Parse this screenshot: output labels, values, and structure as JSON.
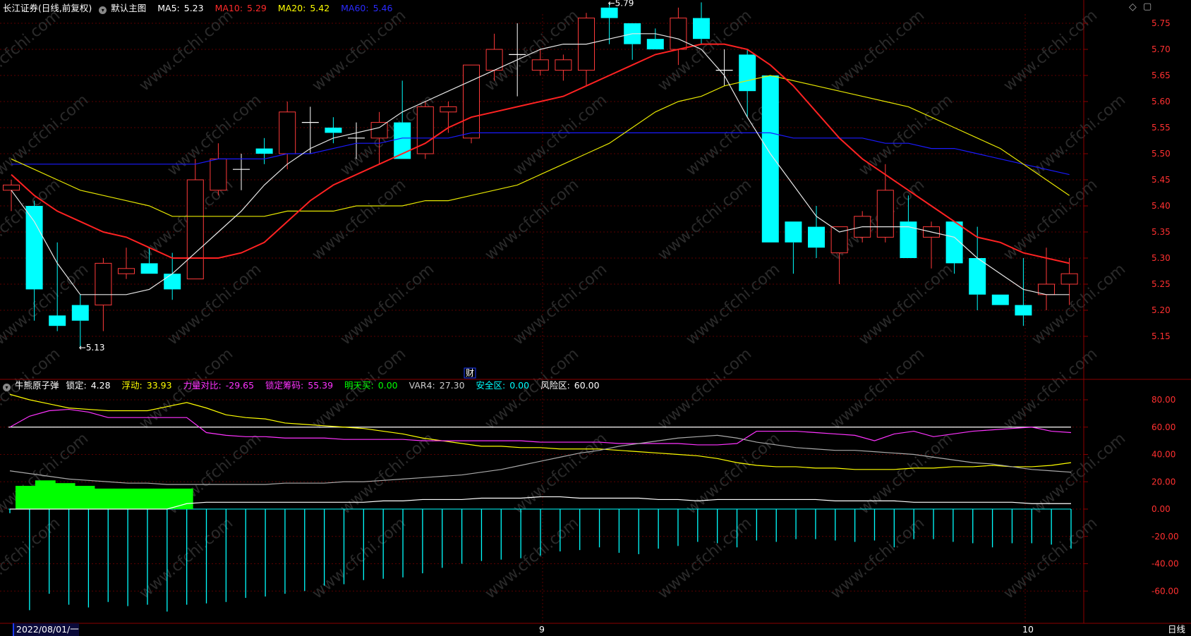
{
  "header": {
    "security": "长江证券",
    "mode": "(日线,前复权)",
    "template": "默认主图",
    "ma": [
      {
        "label": "MA5:",
        "value": "5.23",
        "color": "#ffffff"
      },
      {
        "label": "MA10:",
        "value": "5.29",
        "color": "#ff2a2a"
      },
      {
        "label": "MA20:",
        "value": "5.42",
        "color": "#ffff00"
      },
      {
        "label": "MA60:",
        "value": "5.46",
        "color": "#0000ff"
      }
    ]
  },
  "indicator_header": {
    "name": "牛熊原子弹",
    "items": [
      {
        "label": "锁定:",
        "value": "4.28",
        "color": "#ffffff"
      },
      {
        "label": "浮动:",
        "value": "33.93",
        "color": "#ffff00"
      },
      {
        "label": "力量对比:",
        "value": "-29.65",
        "color": "#ff33ff"
      },
      {
        "label": "锁定筹码:",
        "value": "55.39",
        "color": "#ff33ff"
      },
      {
        "label": "明天买:",
        "value": "0.00",
        "color": "#00ff00"
      },
      {
        "label": "VAR4:",
        "value": "27.30",
        "color": "#cccccc"
      },
      {
        "label": "安全区:",
        "value": "0.00",
        "color": "#00ffff"
      },
      {
        "label": "风险区:",
        "value": "60.00",
        "color": "#ffffff"
      }
    ]
  },
  "bottom": {
    "date": "2022/08/01/一",
    "month_9": "9",
    "month_10": "10",
    "period": "日线"
  },
  "markers": {
    "high": "5.79",
    "low": "5.13",
    "finance": "财"
  },
  "watermark": "www.cfchi.com",
  "chart_data": [
    {
      "type": "candlestick",
      "yticks": [
        "5.75",
        "5.70",
        "5.65",
        "5.60",
        "5.55",
        "5.50",
        "5.45",
        "5.40",
        "5.35",
        "5.30",
        "5.25",
        "5.20",
        "5.15"
      ],
      "ylim": [
        5.1,
        5.8
      ],
      "candles": [
        {
          "o": 5.43,
          "h": 5.45,
          "l": 5.39,
          "c": 5.44
        },
        {
          "o": 5.4,
          "h": 5.41,
          "l": 5.18,
          "c": 5.24
        },
        {
          "o": 5.19,
          "h": 5.33,
          "l": 5.16,
          "c": 5.17
        },
        {
          "o": 5.21,
          "h": 5.23,
          "l": 5.13,
          "c": 5.18
        },
        {
          "o": 5.21,
          "h": 5.3,
          "l": 5.16,
          "c": 5.29
        },
        {
          "o": 5.27,
          "h": 5.32,
          "l": 5.26,
          "c": 5.28
        },
        {
          "o": 5.29,
          "h": 5.32,
          "l": 5.27,
          "c": 5.27
        },
        {
          "o": 5.27,
          "h": 5.31,
          "l": 5.22,
          "c": 5.24
        },
        {
          "o": 5.26,
          "h": 5.49,
          "l": 5.26,
          "c": 5.45
        },
        {
          "o": 5.43,
          "h": 5.52,
          "l": 5.42,
          "c": 5.49
        },
        {
          "o": 5.47,
          "h": 5.5,
          "l": 5.43,
          "c": 5.47
        },
        {
          "o": 5.51,
          "h": 5.53,
          "l": 5.48,
          "c": 5.5
        },
        {
          "o": 5.5,
          "h": 5.6,
          "l": 5.47,
          "c": 5.58
        },
        {
          "o": 5.56,
          "h": 5.59,
          "l": 5.5,
          "c": 5.56
        },
        {
          "o": 5.55,
          "h": 5.57,
          "l": 5.52,
          "c": 5.54
        },
        {
          "o": 5.53,
          "h": 5.56,
          "l": 5.49,
          "c": 5.53
        },
        {
          "o": 5.53,
          "h": 5.58,
          "l": 5.48,
          "c": 5.56
        },
        {
          "o": 5.56,
          "h": 5.64,
          "l": 5.49,
          "c": 5.49
        },
        {
          "o": 5.5,
          "h": 5.6,
          "l": 5.49,
          "c": 5.59
        },
        {
          "o": 5.58,
          "h": 5.6,
          "l": 5.54,
          "c": 5.59
        },
        {
          "o": 5.53,
          "h": 5.67,
          "l": 5.52,
          "c": 5.67
        },
        {
          "o": 5.66,
          "h": 5.73,
          "l": 5.64,
          "c": 5.7
        },
        {
          "o": 5.69,
          "h": 5.75,
          "l": 5.61,
          "c": 5.69
        },
        {
          "o": 5.66,
          "h": 5.7,
          "l": 5.65,
          "c": 5.68
        },
        {
          "o": 5.66,
          "h": 5.69,
          "l": 5.64,
          "c": 5.68
        },
        {
          "o": 5.66,
          "h": 5.77,
          "l": 5.63,
          "c": 5.76
        },
        {
          "o": 5.78,
          "h": 5.79,
          "l": 5.71,
          "c": 5.76
        },
        {
          "o": 5.75,
          "h": 5.75,
          "l": 5.68,
          "c": 5.71
        },
        {
          "o": 5.72,
          "h": 5.74,
          "l": 5.7,
          "c": 5.7
        },
        {
          "o": 5.7,
          "h": 5.78,
          "l": 5.67,
          "c": 5.76
        },
        {
          "o": 5.76,
          "h": 5.79,
          "l": 5.71,
          "c": 5.72
        },
        {
          "o": 5.66,
          "h": 5.7,
          "l": 5.63,
          "c": 5.66
        },
        {
          "o": 5.69,
          "h": 5.7,
          "l": 5.57,
          "c": 5.62
        },
        {
          "o": 5.65,
          "h": 5.65,
          "l": 5.33,
          "c": 5.33
        },
        {
          "o": 5.37,
          "h": 5.37,
          "l": 5.27,
          "c": 5.33
        },
        {
          "o": 5.36,
          "h": 5.4,
          "l": 5.3,
          "c": 5.32
        },
        {
          "o": 5.31,
          "h": 5.36,
          "l": 5.25,
          "c": 5.36
        },
        {
          "o": 5.34,
          "h": 5.39,
          "l": 5.33,
          "c": 5.38
        },
        {
          "o": 5.34,
          "h": 5.48,
          "l": 5.33,
          "c": 5.43
        },
        {
          "o": 5.37,
          "h": 5.42,
          "l": 5.3,
          "c": 5.3
        },
        {
          "o": 5.34,
          "h": 5.37,
          "l": 5.28,
          "c": 5.36
        },
        {
          "o": 5.37,
          "h": 5.37,
          "l": 5.27,
          "c": 5.29
        },
        {
          "o": 5.3,
          "h": 5.36,
          "l": 5.2,
          "c": 5.23
        },
        {
          "o": 5.23,
          "h": 5.23,
          "l": 5.21,
          "c": 5.21
        },
        {
          "o": 5.21,
          "h": 5.3,
          "l": 5.17,
          "c": 5.19
        },
        {
          "o": 5.23,
          "h": 5.32,
          "l": 5.2,
          "c": 5.25
        },
        {
          "o": 5.25,
          "h": 5.3,
          "l": 5.21,
          "c": 5.27
        }
      ],
      "ma5": [
        5.43,
        5.37,
        5.29,
        5.23,
        5.23,
        5.23,
        5.24,
        5.27,
        5.31,
        5.35,
        5.39,
        5.44,
        5.48,
        5.51,
        5.53,
        5.54,
        5.55,
        5.58,
        5.6,
        5.62,
        5.64,
        5.66,
        5.68,
        5.7,
        5.71,
        5.71,
        5.72,
        5.73,
        5.73,
        5.72,
        5.7,
        5.65,
        5.57,
        5.5,
        5.44,
        5.38,
        5.35,
        5.36,
        5.36,
        5.36,
        5.35,
        5.34,
        5.3,
        5.27,
        5.24,
        5.23,
        5.23
      ],
      "ma10": [
        5.46,
        5.42,
        5.39,
        5.37,
        5.35,
        5.34,
        5.32,
        5.3,
        5.3,
        5.3,
        5.31,
        5.33,
        5.37,
        5.41,
        5.44,
        5.46,
        5.48,
        5.5,
        5.52,
        5.55,
        5.57,
        5.58,
        5.59,
        5.6,
        5.61,
        5.63,
        5.65,
        5.67,
        5.69,
        5.7,
        5.71,
        5.71,
        5.7,
        5.67,
        5.63,
        5.58,
        5.53,
        5.49,
        5.46,
        5.43,
        5.4,
        5.37,
        5.34,
        5.33,
        5.31,
        5.3,
        5.29
      ],
      "ma20": [
        5.49,
        5.47,
        5.45,
        5.43,
        5.42,
        5.41,
        5.4,
        5.38,
        5.38,
        5.38,
        5.38,
        5.38,
        5.39,
        5.39,
        5.39,
        5.4,
        5.4,
        5.4,
        5.41,
        5.41,
        5.42,
        5.43,
        5.44,
        5.46,
        5.48,
        5.5,
        5.52,
        5.55,
        5.58,
        5.6,
        5.61,
        5.63,
        5.64,
        5.65,
        5.64,
        5.63,
        5.62,
        5.61,
        5.6,
        5.59,
        5.57,
        5.55,
        5.53,
        5.51,
        5.48,
        5.45,
        5.42
      ],
      "ma60": [
        5.48,
        5.48,
        5.48,
        5.48,
        5.48,
        5.48,
        5.48,
        5.48,
        5.48,
        5.49,
        5.49,
        5.49,
        5.5,
        5.5,
        5.51,
        5.52,
        5.52,
        5.53,
        5.53,
        5.53,
        5.54,
        5.54,
        5.54,
        5.54,
        5.54,
        5.54,
        5.54,
        5.54,
        5.54,
        5.54,
        5.54,
        5.54,
        5.54,
        5.54,
        5.53,
        5.53,
        5.53,
        5.53,
        5.52,
        5.52,
        5.51,
        5.51,
        5.5,
        5.49,
        5.48,
        5.47,
        5.46
      ]
    },
    {
      "type": "line",
      "yticks": [
        "80.00",
        "60.00",
        "40.00",
        "20.00",
        "0.00",
        "-20.00",
        "-40.00",
        "-60.00"
      ],
      "ylim": [
        -80,
        90
      ],
      "risk_level": 60,
      "series": [
        {
          "name": "浮动",
          "color": "#ffff00",
          "values": [
            84,
            80,
            77,
            74,
            73,
            72,
            72,
            72,
            75,
            78,
            74,
            69,
            67,
            66,
            63,
            62,
            61,
            60,
            59,
            57,
            55,
            52,
            50,
            48,
            46,
            46,
            45,
            45,
            44,
            44,
            44,
            43,
            42,
            41,
            40,
            39,
            37,
            34,
            32,
            31,
            31,
            30,
            30,
            29,
            29,
            29,
            30,
            30,
            31,
            31,
            32,
            31,
            31,
            32,
            34
          ]
        },
        {
          "name": "力量对比",
          "color": "#ff33ff",
          "values": [
            60,
            68,
            72,
            73,
            71,
            67,
            67,
            67,
            67,
            67,
            56,
            54,
            53,
            53,
            52,
            52,
            52,
            51,
            51,
            51,
            51,
            50,
            50,
            50,
            50,
            50,
            50,
            49,
            49,
            49,
            49,
            48,
            48,
            48,
            48,
            47,
            47,
            48,
            57,
            57,
            57,
            56,
            55,
            54,
            50,
            55,
            57,
            53,
            55,
            57,
            58,
            59,
            60,
            57,
            56
          ]
        },
        {
          "name": "VAR4",
          "color": "#aaaaaa",
          "values": [
            28,
            26,
            24,
            22,
            21,
            20,
            19,
            19,
            18,
            18,
            18,
            18,
            18,
            18,
            19,
            19,
            19,
            20,
            20,
            21,
            22,
            23,
            24,
            25,
            27,
            29,
            32,
            35,
            38,
            41,
            43,
            46,
            48,
            50,
            52,
            53,
            54,
            52,
            49,
            47,
            45,
            44,
            43,
            43,
            42,
            41,
            40,
            38,
            36,
            34,
            33,
            31,
            29,
            28,
            27
          ]
        },
        {
          "name": "锁定",
          "color": "#ffffff",
          "values": [
            0,
            0,
            0,
            0,
            0,
            0,
            0,
            0,
            0,
            4,
            5,
            5,
            5,
            5,
            5,
            5,
            5,
            5,
            5,
            6,
            6,
            7,
            7,
            7,
            8,
            8,
            8,
            9,
            9,
            8,
            8,
            8,
            8,
            7,
            7,
            6,
            7,
            7,
            7,
            7,
            7,
            7,
            6,
            6,
            6,
            6,
            5,
            5,
            5,
            5,
            5,
            5,
            4,
            4,
            4
          ]
        },
        {
          "name": "明天买",
          "color": "#00ff00",
          "values": [
            0,
            17,
            21,
            19,
            17,
            15,
            15,
            15,
            15,
            15
          ]
        },
        {
          "name": "安全区",
          "color": "#00ffff",
          "values": [
            -3,
            -74,
            -62,
            -70,
            -72,
            -68,
            -71,
            -70,
            -75,
            -70,
            -69,
            -68,
            -65,
            -64,
            -62,
            -60,
            -56,
            -55,
            -52,
            -51,
            -50,
            -47,
            -43,
            -40,
            -38,
            -37,
            -36,
            -34,
            -31,
            -30,
            -28,
            -32,
            -33,
            -29,
            -27,
            -24,
            -25,
            -28,
            -23,
            -24,
            -22,
            -22,
            -23,
            -24,
            -23,
            -28,
            -22,
            -22,
            -24,
            -25,
            -28,
            -25,
            -25,
            -26,
            -29
          ]
        }
      ]
    }
  ]
}
